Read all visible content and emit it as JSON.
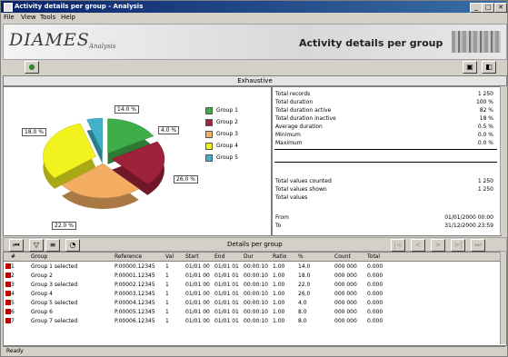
{
  "window": {
    "title": "Activity details per group - Analysis",
    "min": "_",
    "max": "□",
    "close": "✕"
  },
  "menu": [
    "File",
    "View",
    "Tools",
    "Help"
  ],
  "header": {
    "logo": "DIAMES",
    "logo_sub": "Analysis",
    "title": "Activity details per group"
  },
  "section_title": "Exhaustive",
  "legend": [
    {
      "label": "Group 1",
      "color": "#3fae49"
    },
    {
      "label": "Group 2",
      "color": "#a0223a"
    },
    {
      "label": "Group 3",
      "color": "#f2ad63"
    },
    {
      "label": "Group 4",
      "color": "#f2f21e"
    },
    {
      "label": "Group 5",
      "color": "#42b0c8"
    }
  ],
  "chart_data": {
    "type": "pie",
    "labels": [
      "Group 1",
      "Group 2",
      "Group 3",
      "Group 4",
      "Group 5"
    ],
    "values": [
      14,
      18,
      22,
      26,
      4
    ],
    "colors": [
      "#3fae49",
      "#a0223a",
      "#f2ad63",
      "#f2f21e",
      "#42b0c8"
    ],
    "callouts": [
      "14.0 %",
      "18.0 %",
      "22.0 %",
      "26.0 %",
      "4.0 %"
    ]
  },
  "info_rows": [
    {
      "label": "Total records",
      "value": "1 250"
    },
    {
      "label": "Total duration",
      "value": "100 %"
    },
    {
      "label": "Total duration active",
      "value": "82 %"
    },
    {
      "label": "Total duration inactive",
      "value": "18 %"
    },
    {
      "label": "Average duration",
      "value": "0.5 %"
    },
    {
      "label": "Minimum",
      "value": "0.0 %"
    },
    {
      "label": "Maximum",
      "value": "0.0 %"
    }
  ],
  "info_rows2": [
    {
      "label": "Total values counted",
      "value": "1 250"
    },
    {
      "label": "Total values shown",
      "value": "1 250"
    },
    {
      "label": "Total values",
      "value": ""
    }
  ],
  "info_rows3": [
    {
      "label": "From",
      "value": "01/01/2000 00:00"
    },
    {
      "label": "To",
      "value": "31/12/2000 23:59"
    }
  ],
  "grid": {
    "title": "Details per group",
    "columns": [
      "#",
      "Group",
      "Reference",
      "Val",
      "Start",
      "End",
      "Dur",
      "Ratio",
      "%",
      "Count",
      "Total"
    ],
    "rows": [
      [
        "1",
        "Group 1 selected",
        "P.00000.12345",
        "1",
        "01/01 00",
        "01/01 01",
        "00:00:10",
        "1.00",
        "14.0",
        "000 000",
        "0.000"
      ],
      [
        "2",
        "Group 2",
        "P.00001.12345",
        "1",
        "01/01 00",
        "01/01 01",
        "00:00:10",
        "1.00",
        "18.0",
        "000 000",
        "0.000"
      ],
      [
        "3",
        "Group 3 selected",
        "P.00002.12345",
        "1",
        "01/01 00",
        "01/01 01",
        "00:00:10",
        "1.00",
        "22.0",
        "000 000",
        "0.000"
      ],
      [
        "4",
        "Group 4",
        "P.00003.12345",
        "1",
        "01/01 00",
        "01/01 01",
        "00:00:10",
        "1.00",
        "26.0",
        "000 000",
        "0.000"
      ],
      [
        "5",
        "Group 5 selected",
        "P.00004.12345",
        "1",
        "01/01 00",
        "01/01 01",
        "00:00:10",
        "1.00",
        "4.0",
        "000 000",
        "0.000"
      ],
      [
        "6",
        "Group 6",
        "P.00005.12345",
        "1",
        "01/01 00",
        "01/01 01",
        "00:00:10",
        "1.00",
        "8.0",
        "000 000",
        "0.000"
      ],
      [
        "7",
        "Group 7 selected",
        "P.00006.12345",
        "1",
        "01/01 00",
        "01/01 01",
        "00:00:10",
        "1.00",
        "8.0",
        "000 000",
        "0.000"
      ]
    ],
    "row_icon_colors": [
      "#c00000",
      "#c00000",
      "#c00000",
      "#c00000",
      "#c00000",
      "#c00000",
      "#c00000"
    ]
  },
  "status": "Ready"
}
